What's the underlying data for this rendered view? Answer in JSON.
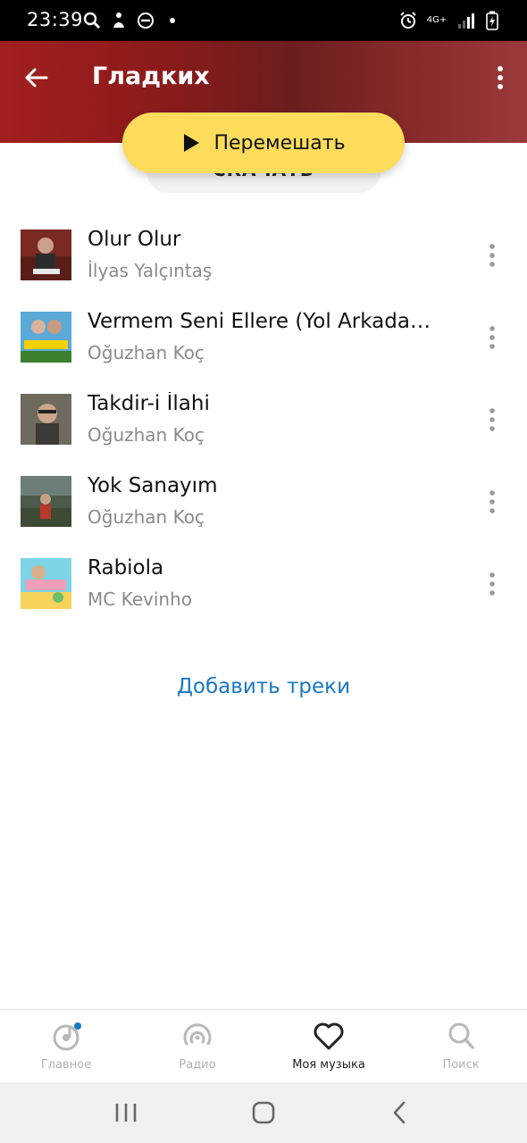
{
  "status_bar": {
    "time": "23:39",
    "left_icons": [
      "search-icon",
      "accessibility-icon",
      "do-not-disturb-icon",
      "dot-icon"
    ],
    "network": "4G+",
    "right_icons": [
      "alarm-icon",
      "signal-icon",
      "battery-charging-icon"
    ]
  },
  "header": {
    "title": "Гладких",
    "background_color": "#8c1b1b"
  },
  "actions": {
    "shuffle_label": "Перемешать",
    "download_label": "СКАЧАТЬ",
    "accent_color": "#fddc5c"
  },
  "tracks": [
    {
      "title": "Olur Olur",
      "artist": "İlyas Yalçıntaş"
    },
    {
      "title": "Vermem Seni Ellere (Yol Arkadaşı...",
      "artist": "Oğuzhan Koç"
    },
    {
      "title": "Takdir-i İlahi",
      "artist": "Oğuzhan Koç"
    },
    {
      "title": "Yok Sanayım",
      "artist": "Oğuzhan Koç"
    },
    {
      "title": "Rabiola",
      "artist": "MC Kevinho"
    }
  ],
  "add_tracks_label": "Добавить треки",
  "bottom_nav": [
    {
      "label": "Главное",
      "icon": "home-music-icon",
      "active": false
    },
    {
      "label": "Радио",
      "icon": "radio-icon",
      "active": false
    },
    {
      "label": "Моя музыка",
      "icon": "heart-icon",
      "active": true
    },
    {
      "label": "Поиск",
      "icon": "search-icon",
      "active": false
    }
  ],
  "system_nav": [
    "recents-icon",
    "home-icon",
    "back-icon"
  ]
}
